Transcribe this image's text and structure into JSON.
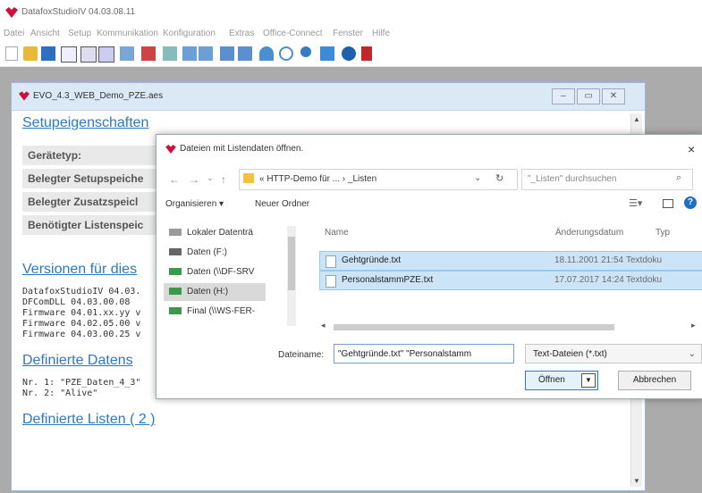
{
  "app": {
    "title": "DatafoxStudioIV 04.03.08.11",
    "logo_color": "#d0103a"
  },
  "menu": [
    "Datei",
    "Ansicht",
    "Setup",
    "Kommunikation",
    "Konfiguration",
    "Extras",
    "Office-Connect",
    "Fenster",
    "Hilfe"
  ],
  "toolbar_icons": [
    "new-icon",
    "open-folder-icon",
    "save-icon",
    "table-icon",
    "grid-icon",
    "grid-edit-icon",
    "device-icon",
    "transfer-icon",
    "list-icon",
    "import-icon",
    "export-icon",
    "send-icon",
    "receive-icon",
    "users-icon",
    "clock-icon",
    "search-icon",
    "monitor-icon",
    "settings-icon",
    "book-icon"
  ],
  "mdi": {
    "title": "EVO_4.3_WEB_Demo_PZE.aes",
    "sections": {
      "setup": "Setupeigenschaften",
      "versions": "Versionen für dies",
      "datasets": "Definierte Datens",
      "lists": "Definierte Listen ( 2 )"
    },
    "properties": [
      "Gerätetyp:",
      "Belegter Setupspeiche",
      "Belegter Zusatzspeicl",
      "Benötigter Listenspeic"
    ],
    "versions": [
      "DatafoxStudioIV 04.03.",
      "DFComDLL 04.03.00.08",
      "Firmware 04.01.xx.yy v",
      "Firmware 04.02.05.00 v",
      "Firmware 04.03.00.25 v"
    ],
    "datasets": [
      "Nr. 1: \"PZE_Daten_4_3\"",
      "Nr. 2: \"Alive\""
    ]
  },
  "dialog": {
    "title": "Dateien mit Listendaten öffnen.",
    "close": "×",
    "breadcrumb": "« HTTP-Demo für ... › _Listen",
    "search_placeholder": "\"_Listen\" durchsuchen",
    "organize": "Organisieren ▾",
    "new_folder": "Neuer Ordner",
    "nav_items": [
      "Lokaler Datenträ",
      "Daten (F:)",
      "Daten (\\\\DF-SRV",
      "Daten (H:)",
      "Final (\\\\WS-FER-"
    ],
    "columns": {
      "name": "Name",
      "date": "Änderungsdatum",
      "type": "Typ"
    },
    "files": [
      {
        "name": "Gehtgründe.txt",
        "date": "18.11.2001 21:54",
        "type": "Textdoku"
      },
      {
        "name": "PersonalstammPZE.txt",
        "date": "17.07.2017 14:24",
        "type": "Textdoku"
      }
    ],
    "filename_label": "Dateiname:",
    "filename_value": "\"Gehtgründe.txt\" \"Personalstamm",
    "filter": "Text-Dateien (*.txt)",
    "open": "Öffnen",
    "cancel": "Abbrechen"
  }
}
